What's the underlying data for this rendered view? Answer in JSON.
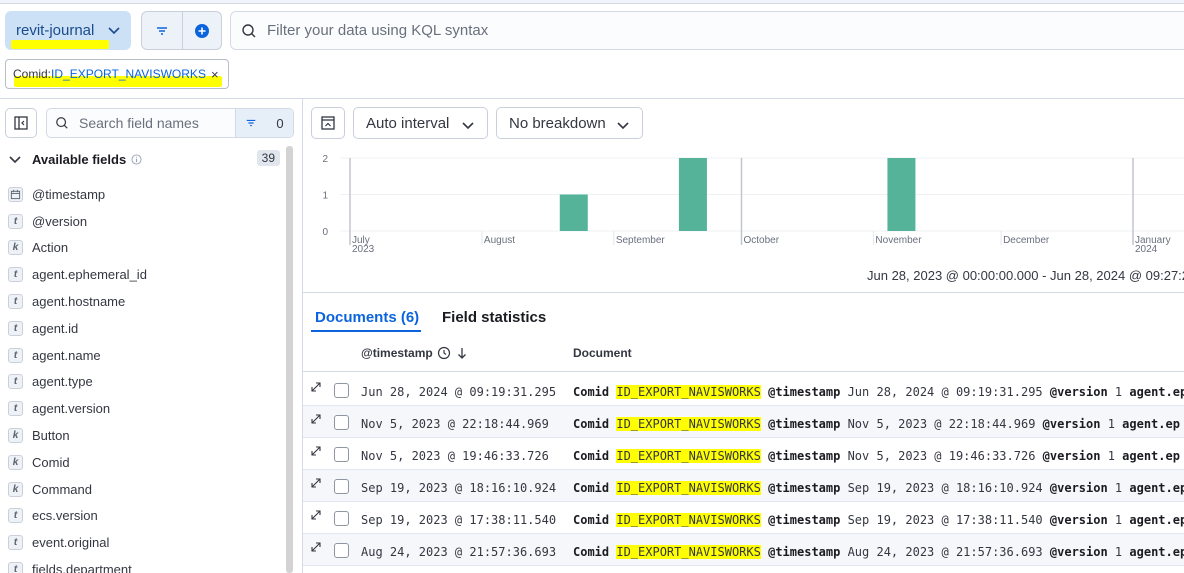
{
  "header": {
    "dataview": "revit-journal",
    "kql_placeholder": "Filter your data using KQL syntax",
    "icons": [
      "chevron-down-icon",
      "filter-icon",
      "plus-circle-icon",
      "search-icon"
    ]
  },
  "filter_pill": {
    "label": "Comid: ",
    "value": "ID_EXPORT_NAVISWORKS",
    "close": "×"
  },
  "sidebar": {
    "search_placeholder": "Search field names",
    "filter_count": "0",
    "available_label": "Available fields",
    "available_count": "39",
    "fields": [
      {
        "type": "date",
        "badge": "",
        "name": "@timestamp"
      },
      {
        "type": "text",
        "badge": "t",
        "name": "@version"
      },
      {
        "type": "keyword",
        "badge": "k",
        "name": "Action"
      },
      {
        "type": "text",
        "badge": "t",
        "name": "agent.ephemeral_id"
      },
      {
        "type": "text",
        "badge": "t",
        "name": "agent.hostname"
      },
      {
        "type": "text",
        "badge": "t",
        "name": "agent.id"
      },
      {
        "type": "text",
        "badge": "t",
        "name": "agent.name"
      },
      {
        "type": "text",
        "badge": "t",
        "name": "agent.type"
      },
      {
        "type": "text",
        "badge": "t",
        "name": "agent.version"
      },
      {
        "type": "keyword",
        "badge": "k",
        "name": "Button"
      },
      {
        "type": "keyword",
        "badge": "k",
        "name": "Comid"
      },
      {
        "type": "keyword",
        "badge": "k",
        "name": "Command"
      },
      {
        "type": "text",
        "badge": "t",
        "name": "ecs.version"
      },
      {
        "type": "text",
        "badge": "t",
        "name": "event.original"
      },
      {
        "type": "text",
        "badge": "t",
        "name": "fields.department"
      }
    ]
  },
  "chart_toolbar": {
    "interval": "Auto interval",
    "breakdown": "No breakdown"
  },
  "chart_data": {
    "type": "bar",
    "x": [
      "2023-08-24",
      "2023-09-19",
      "2023-11-05"
    ],
    "values": [
      1,
      2,
      2
    ],
    "yticks": [
      "2",
      "1",
      "0"
    ],
    "ylim": [
      0,
      2
    ],
    "xticks": [
      {
        "label": "July",
        "sub": "2023"
      },
      {
        "label": "August",
        "sub": ""
      },
      {
        "label": "September",
        "sub": ""
      },
      {
        "label": "October",
        "sub": ""
      },
      {
        "label": "November",
        "sub": ""
      },
      {
        "label": "December",
        "sub": ""
      },
      {
        "label": "January",
        "sub": "2024"
      }
    ],
    "bar_color": "#54b399",
    "grid": true
  },
  "time_range": "Jun 28, 2023 @ 00:00:00.000 - Jun 28, 2024 @ 09:27:2",
  "tabs": [
    {
      "label": "Documents (6)",
      "active": true
    },
    {
      "label": "Field statistics",
      "active": false
    }
  ],
  "table": {
    "col_timestamp": "@timestamp",
    "col_document": "Document",
    "rows": [
      {
        "ts": "Jun 28, 2024 @ 09:19:31.295",
        "comid_key": "Comid",
        "comid_val": "ID_EXPORT_NAVISWORKS",
        "ts_key": "@timestamp",
        "ts_val": "Jun 28, 2024 @ 09:19:31.295",
        "ver_key": "@version",
        "ver_val": "1",
        "agent_key": "agent.ep"
      },
      {
        "ts": "Nov 5, 2023 @ 22:18:44.969",
        "comid_key": "Comid",
        "comid_val": "ID_EXPORT_NAVISWORKS",
        "ts_key": "@timestamp",
        "ts_val": "Nov 5, 2023 @ 22:18:44.969",
        "ver_key": "@version",
        "ver_val": "1",
        "agent_key": "agent.ep"
      },
      {
        "ts": "Nov 5, 2023 @ 19:46:33.726",
        "comid_key": "Comid",
        "comid_val": "ID_EXPORT_NAVISWORKS",
        "ts_key": "@timestamp",
        "ts_val": "Nov 5, 2023 @ 19:46:33.726",
        "ver_key": "@version",
        "ver_val": "1",
        "agent_key": "agent.ep"
      },
      {
        "ts": "Sep 19, 2023 @ 18:16:10.924",
        "comid_key": "Comid",
        "comid_val": "ID_EXPORT_NAVISWORKS",
        "ts_key": "@timestamp",
        "ts_val": "Sep 19, 2023 @ 18:16:10.924",
        "ver_key": "@version",
        "ver_val": "1",
        "agent_key": "agent.ep"
      },
      {
        "ts": "Sep 19, 2023 @ 17:38:11.540",
        "comid_key": "Comid",
        "comid_val": "ID_EXPORT_NAVISWORKS",
        "ts_key": "@timestamp",
        "ts_val": "Sep 19, 2023 @ 17:38:11.540",
        "ver_key": "@version",
        "ver_val": "1",
        "agent_key": "agent.ep"
      },
      {
        "ts": "Aug 24, 2023 @ 21:57:36.693",
        "comid_key": "Comid",
        "comid_val": "ID_EXPORT_NAVISWORKS",
        "ts_key": "@timestamp",
        "ts_val": "Aug 24, 2023 @ 21:57:36.693",
        "ver_key": "@version",
        "ver_val": "1",
        "agent_key": "agent.ep"
      }
    ]
  }
}
